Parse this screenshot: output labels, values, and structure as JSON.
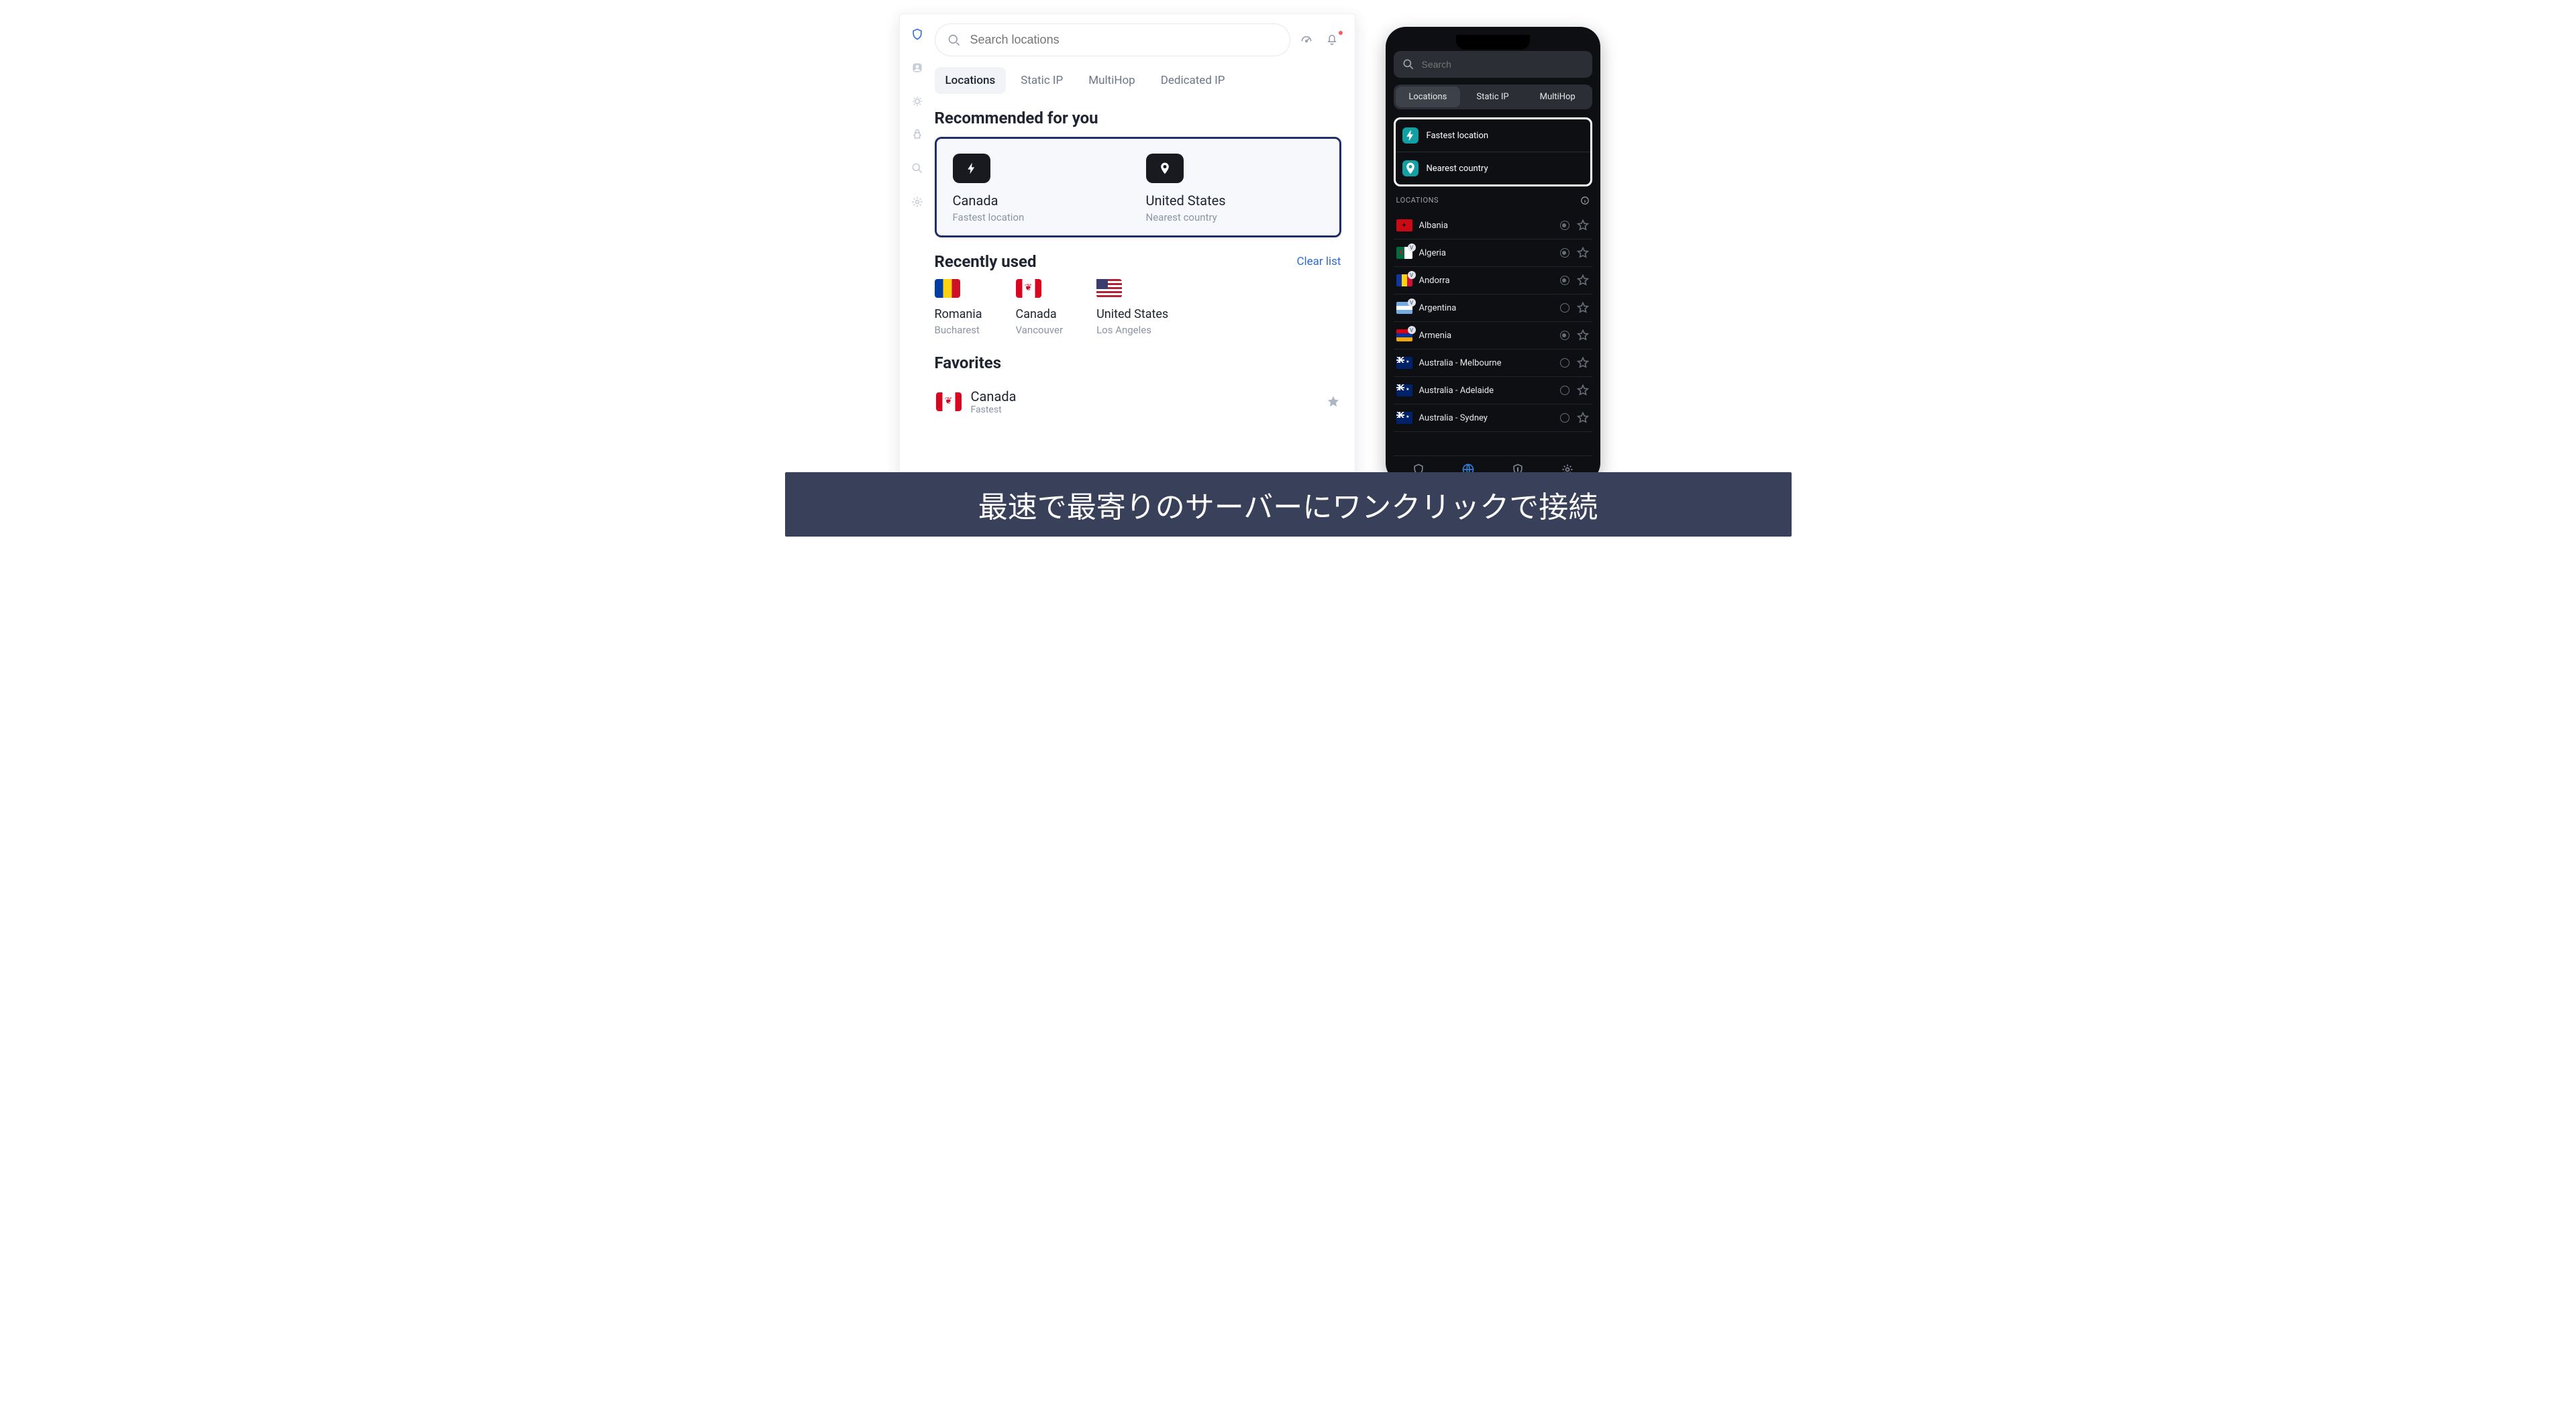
{
  "desktop": {
    "search": {
      "placeholder": "Search locations"
    },
    "tabs": [
      "Locations",
      "Static IP",
      "MultiHop",
      "Dedicated IP"
    ],
    "recommended": {
      "heading": "Recommended for you",
      "items": [
        {
          "title": "Canada",
          "sub": "Fastest location",
          "icon": "bolt"
        },
        {
          "title": "United States",
          "sub": "Nearest country",
          "icon": "pin"
        }
      ]
    },
    "recent": {
      "heading": "Recently used",
      "clear": "Clear list",
      "items": [
        {
          "title": "Romania",
          "sub": "Bucharest",
          "flag": "ro"
        },
        {
          "title": "Canada",
          "sub": "Vancouver",
          "flag": "ca"
        },
        {
          "title": "United States",
          "sub": "Los Angeles",
          "flag": "us"
        }
      ]
    },
    "favorites": {
      "heading": "Favorites",
      "items": [
        {
          "title": "Canada",
          "sub": "Fastest",
          "flag": "ca"
        }
      ]
    }
  },
  "phone": {
    "search": {
      "placeholder": "Search"
    },
    "tabs": [
      "Locations",
      "Static IP",
      "MultiHop"
    ],
    "quick": [
      {
        "label": "Fastest location",
        "icon": "bolt"
      },
      {
        "label": "Nearest country",
        "icon": "pin"
      }
    ],
    "locations_header": "LOCATIONS",
    "locations": [
      {
        "name": "Albania",
        "flag": "al",
        "virtual": false,
        "load": "half"
      },
      {
        "name": "Algeria",
        "flag": "dz",
        "virtual": true,
        "load": "half"
      },
      {
        "name": "Andorra",
        "flag": "ad",
        "virtual": true,
        "load": "half"
      },
      {
        "name": "Argentina",
        "flag": "ar",
        "virtual": true,
        "load": "empty"
      },
      {
        "name": "Armenia",
        "flag": "am",
        "virtual": true,
        "load": "half"
      },
      {
        "name": "Australia - Melbourne",
        "flag": "au",
        "virtual": false,
        "load": "empty"
      },
      {
        "name": "Australia - Adelaide",
        "flag": "au",
        "virtual": false,
        "load": "empty"
      },
      {
        "name": "Australia - Sydney",
        "flag": "au",
        "virtual": false,
        "load": "empty"
      }
    ]
  },
  "banner": "最速で最寄りのサーバーにワンクリックで接続"
}
